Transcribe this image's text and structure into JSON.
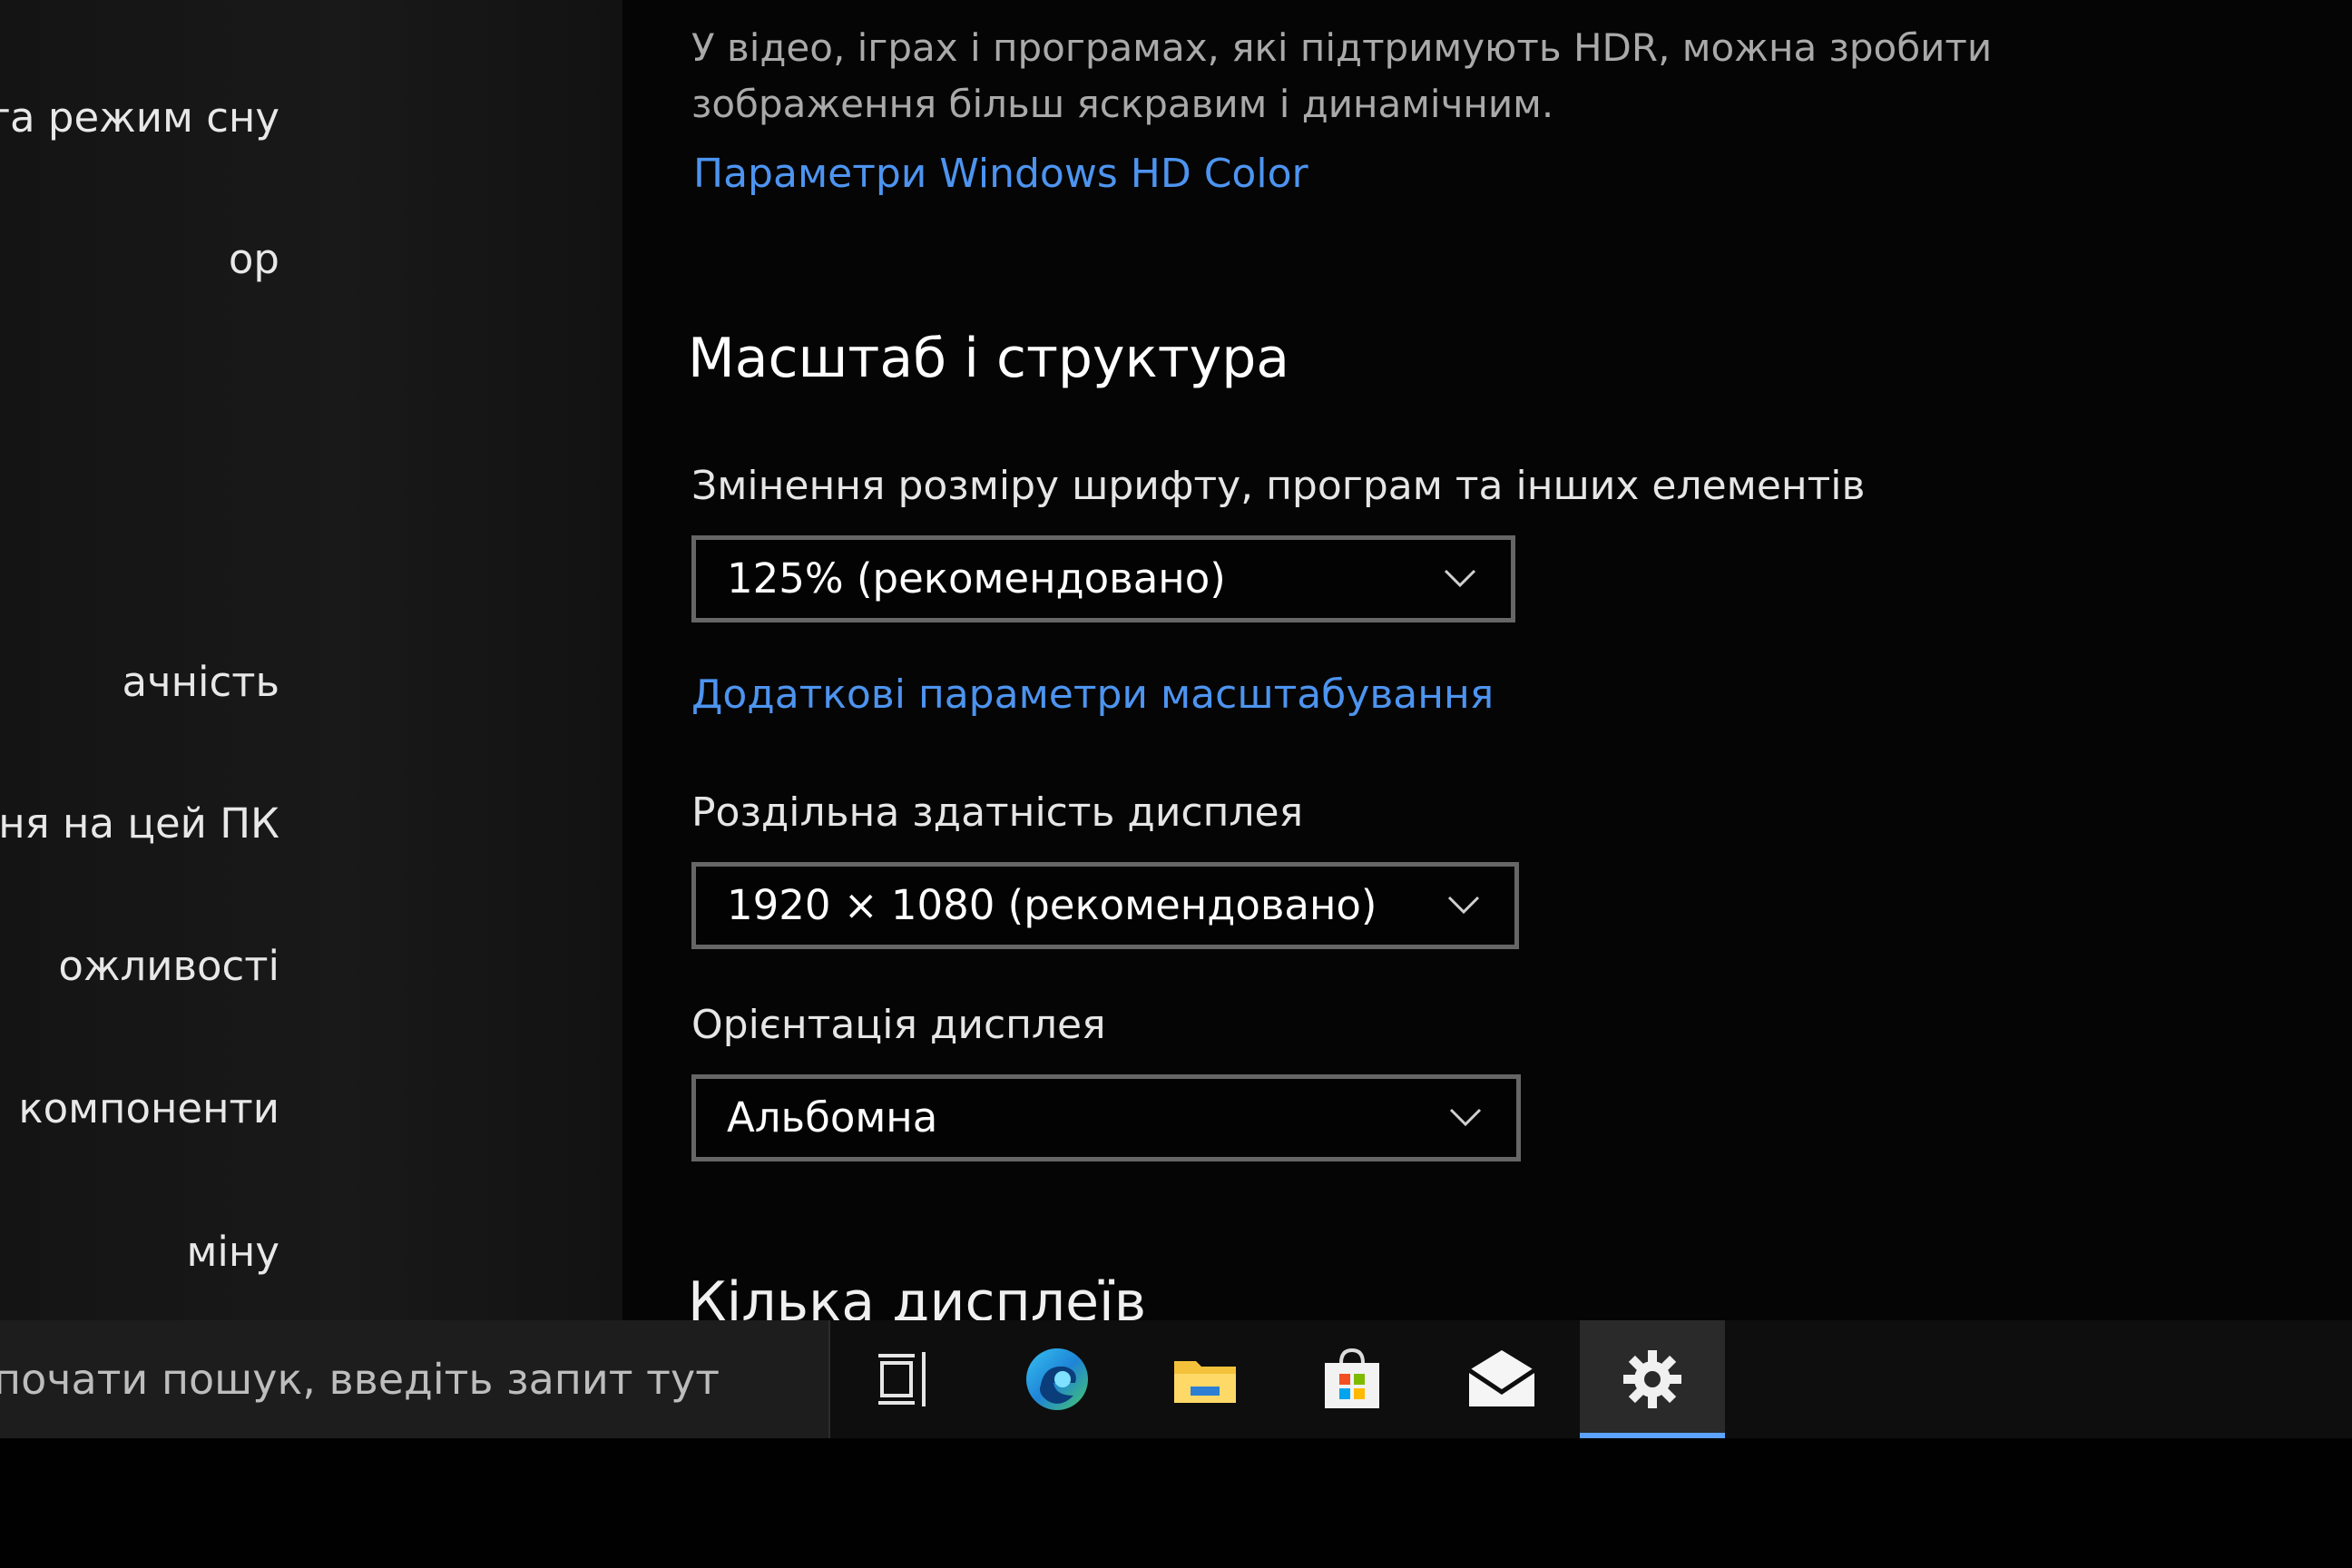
{
  "nav": {
    "items": [
      "я та режим сну",
      "ор",
      "ачність",
      "ання на цей ПК",
      "ожливості",
      "компоненти",
      "міну"
    ]
  },
  "content": {
    "hdr_description": "У відео, іграх і програмах, які підтримують HDR, можна зробити зображення більш яскравим і динамічним.",
    "hdr_link": "Параметри Windows HD Color",
    "scale_section_title": "Масштаб і структура",
    "scale_label": "Змінення розміру шрифту, програм та інших елементів",
    "scale_value": "125% (рекомендовано)",
    "advanced_scaling_link": "Додаткові параметри масштабування",
    "resolution_label": "Роздільна здатність дисплея",
    "resolution_value": "1920 × 1080 (рекомендовано)",
    "orientation_label": "Орієнтація дисплея",
    "orientation_value": "Альбомна",
    "multi_display_title": "Кілька дисплеїв"
  },
  "taskbar": {
    "search_placeholder": "би почати пошук, введіть запит тут",
    "icons": [
      "task-view-icon",
      "edge-icon",
      "file-explorer-icon",
      "store-icon",
      "mail-icon",
      "settings-icon"
    ],
    "active_icon": "settings-icon",
    "accent_color": "#5ba3ff"
  },
  "colors": {
    "link": "#4d94f0",
    "background": "#050505"
  }
}
